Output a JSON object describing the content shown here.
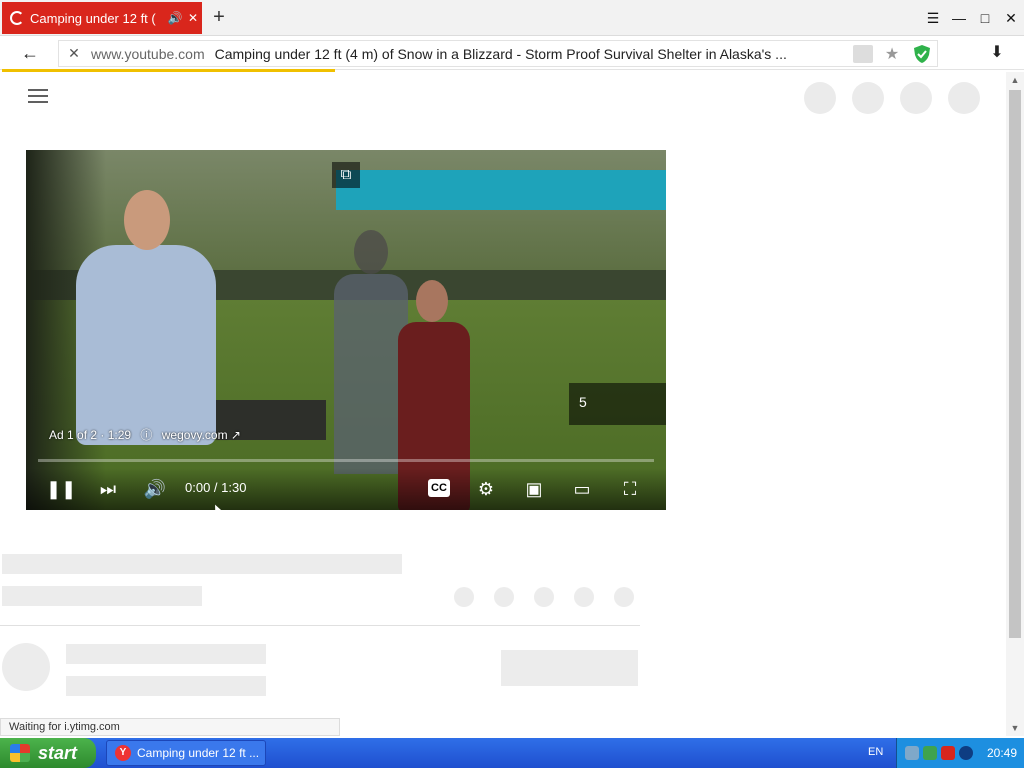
{
  "browser": {
    "tab_title": "Camping under 12 ft (",
    "host": "www.youtube.com",
    "page_title": "Camping under 12 ft (4 m) of Snow in a Blizzard - Storm Proof Survival Shelter in Alaska's ...",
    "loading_progress_pct": 33
  },
  "player": {
    "ad_label": "Ad 1 of 2 · 1:29",
    "ad_domain": "wegovy.com",
    "skip_countdown": "5",
    "time_display": "0:00 / 1:30",
    "progress_pct": 0
  },
  "status_text": "Waiting for i.ytimg.com",
  "taskbar": {
    "start_label": "start",
    "task_title": "Camping under 12 ft ...",
    "language": "EN",
    "clock": "20:49"
  },
  "colors": {
    "tab_red": "#d9261c",
    "load_bar": "#f0c000",
    "progress_yellow": "#f4c20d",
    "xp_blue": "#2f6fe8"
  }
}
